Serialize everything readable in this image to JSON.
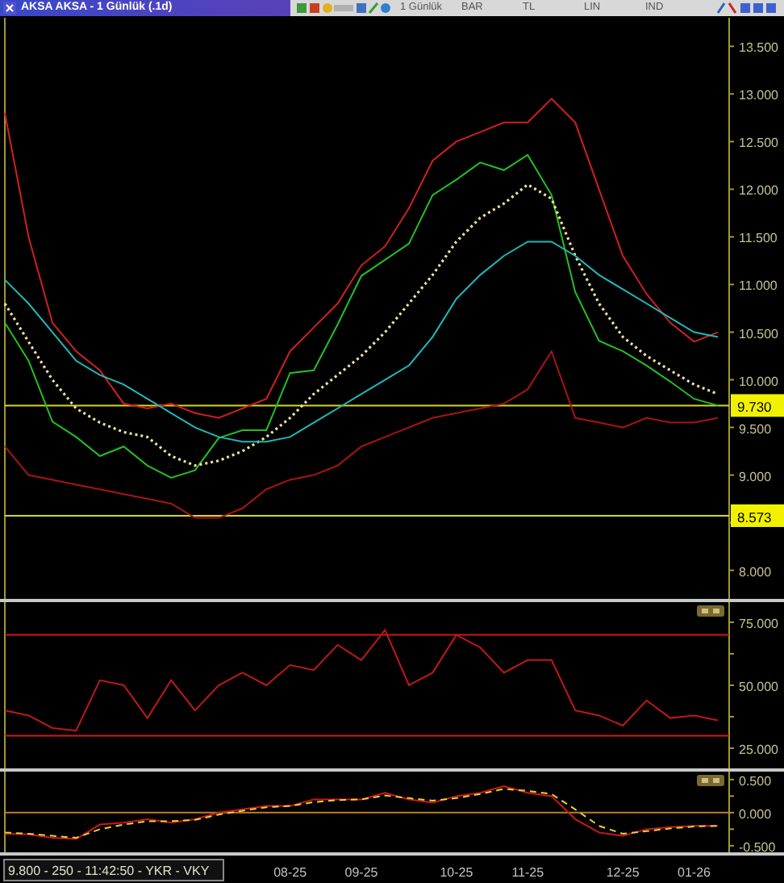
{
  "window": {
    "title": "AKSA AKSA - 1 Günlük (.1d)"
  },
  "toolbar": {
    "items": [
      "1 Günlük",
      "BAR",
      "TL",
      "LIN",
      "IND"
    ]
  },
  "price_panel": {
    "chart_data": {
      "type": "line",
      "categories": [
        null,
        null,
        null,
        null,
        null,
        null,
        null,
        null,
        null,
        null,
        null,
        null,
        null,
        null,
        null,
        null,
        null,
        null,
        null,
        null,
        null,
        null,
        null,
        null,
        null,
        null,
        null,
        null,
        null,
        null,
        null
      ],
      "ylim": [
        7.7,
        13.8
      ],
      "yticks": [
        {
          "value": 8,
          "label": "8.000"
        },
        {
          "value": 9,
          "label": "9.000"
        },
        {
          "value": 9.5,
          "label": "9.500"
        },
        {
          "value": 10,
          "label": "10.000"
        },
        {
          "value": 10.5,
          "label": "10.500"
        },
        {
          "value": 11,
          "label": "11.000"
        },
        {
          "value": 11.5,
          "label": "11.500"
        },
        {
          "value": 12,
          "label": "12.000"
        },
        {
          "value": 12.5,
          "label": "12.500"
        },
        {
          "value": 13,
          "label": "13.000"
        },
        {
          "value": 13.5,
          "label": "13.500"
        }
      ],
      "series": [
        {
          "color": "#22c022",
          "values": [
            10.6,
            10.2,
            9.56,
            9.4,
            9.2,
            9.3,
            9.1,
            8.97,
            9.05,
            9.39,
            9.47,
            9.47,
            10.07,
            10.1,
            10.58,
            11.09,
            11.26,
            11.43,
            11.94,
            12.1,
            12.28,
            12.2,
            12.36,
            11.94,
            10.92,
            10.41,
            10.3,
            10.15,
            9.98,
            9.8,
            9.73
          ]
        },
        {
          "color": "#d02020",
          "values": [
            12.8,
            11.5,
            10.6,
            10.3,
            10.1,
            9.75,
            9.7,
            9.75,
            9.65,
            9.6,
            9.7,
            9.8,
            10.3,
            10.55,
            10.8,
            11.2,
            11.4,
            11.8,
            12.3,
            12.5,
            12.6,
            12.7,
            12.7,
            12.95,
            12.7,
            12.0,
            11.3,
            10.9,
            10.6,
            10.4,
            10.5
          ]
        },
        {
          "color": "#a81414",
          "values": [
            9.3,
            9.0,
            8.95,
            8.9,
            8.85,
            8.8,
            8.75,
            8.7,
            8.55,
            8.55,
            8.65,
            8.85,
            8.95,
            9.0,
            9.1,
            9.3,
            9.4,
            9.5,
            9.6,
            9.65,
            9.7,
            9.75,
            9.9,
            10.3,
            9.6,
            9.55,
            9.5,
            9.6,
            9.55,
            9.55,
            9.6
          ]
        },
        {
          "color": "#f0e0a0",
          "line_style": "dotted",
          "values": [
            10.8,
            10.4,
            10.0,
            9.7,
            9.55,
            9.45,
            9.4,
            9.2,
            9.1,
            9.15,
            9.25,
            9.4,
            9.6,
            9.85,
            10.05,
            10.25,
            10.5,
            10.8,
            11.1,
            11.45,
            11.7,
            11.85,
            12.05,
            11.9,
            11.3,
            10.8,
            10.45,
            10.25,
            10.1,
            9.95,
            9.85
          ]
        },
        {
          "color": "#20b8b8",
          "values": [
            11.05,
            10.8,
            10.5,
            10.2,
            10.05,
            9.95,
            9.8,
            9.65,
            9.5,
            9.4,
            9.35,
            9.35,
            9.4,
            9.55,
            9.7,
            9.85,
            10.0,
            10.15,
            10.45,
            10.85,
            11.1,
            11.3,
            11.45,
            11.45,
            11.3,
            11.1,
            10.95,
            10.8,
            10.65,
            10.5,
            10.45
          ]
        }
      ],
      "ref_lines": [
        {
          "axis": "y",
          "value": 9.73,
          "label": "9.730"
        },
        {
          "axis": "y",
          "value": 8.573,
          "label": "8.573"
        }
      ]
    }
  },
  "rsi_panel": {
    "chart_data": {
      "type": "line",
      "categories": [
        null,
        null,
        null,
        null,
        null,
        null,
        null,
        null,
        null,
        null,
        null,
        null,
        null,
        null,
        null,
        null,
        null,
        null,
        null,
        null,
        null,
        null,
        null,
        null,
        null,
        null,
        null,
        null,
        null,
        null,
        null
      ],
      "ylim": [
        17,
        83
      ],
      "yticks": [
        {
          "value": 25,
          "label": "25.000"
        },
        {
          "value": 50,
          "label": "50.000"
        },
        {
          "value": 75,
          "label": "75.000"
        }
      ],
      "series": [
        {
          "color": "#c01818",
          "values": [
            40,
            38,
            33,
            32,
            52,
            50,
            37,
            52,
            40,
            50,
            55,
            50,
            58,
            56,
            66,
            60,
            72,
            50,
            55,
            70,
            65,
            55,
            60,
            60,
            40,
            38,
            34,
            44,
            37,
            38,
            36
          ]
        }
      ],
      "ref_lines": [
        {
          "axis": "y",
          "value": 70
        },
        {
          "axis": "y",
          "value": 30
        }
      ]
    }
  },
  "macd_panel": {
    "chart_data": {
      "type": "line",
      "categories": [
        null,
        null,
        null,
        null,
        null,
        null,
        null,
        null,
        null,
        null,
        null,
        null,
        "08-25",
        null,
        null,
        "09-25",
        null,
        null,
        null,
        "10-25",
        null,
        null,
        "11-25",
        null,
        null,
        null,
        "12-25",
        null,
        null,
        "01-26",
        null
      ],
      "ylim": [
        -0.6,
        0.62
      ],
      "yticks": [
        {
          "value": -0.5,
          "label": "-0.500"
        },
        {
          "value": 0,
          "label": "0.000"
        },
        {
          "value": 0.5,
          "label": "0.500"
        }
      ],
      "series": [
        {
          "color": "#d01818",
          "values": [
            -0.32,
            -0.33,
            -0.38,
            -0.4,
            -0.18,
            -0.15,
            -0.1,
            -0.15,
            -0.1,
            0.0,
            0.05,
            0.1,
            0.1,
            0.2,
            0.2,
            0.2,
            0.3,
            0.2,
            0.15,
            0.25,
            0.3,
            0.4,
            0.3,
            0.25,
            -0.1,
            -0.3,
            -0.35,
            -0.25,
            -0.22,
            -0.2,
            -0.2
          ]
        },
        {
          "color": "#e8d040",
          "line_style": "dashed",
          "values": [
            -0.3,
            -0.32,
            -0.35,
            -0.38,
            -0.25,
            -0.18,
            -0.13,
            -0.13,
            -0.11,
            -0.03,
            0.03,
            0.08,
            0.1,
            0.16,
            0.19,
            0.2,
            0.26,
            0.22,
            0.18,
            0.22,
            0.28,
            0.36,
            0.33,
            0.28,
            0.05,
            -0.2,
            -0.32,
            -0.28,
            -0.24,
            -0.21,
            -0.2
          ]
        }
      ],
      "ref_lines": [
        {
          "axis": "y",
          "value": 0
        }
      ]
    }
  },
  "status_bar": {
    "text": "9.800 - 250 - 11:42:50 - YKR - VKY"
  }
}
